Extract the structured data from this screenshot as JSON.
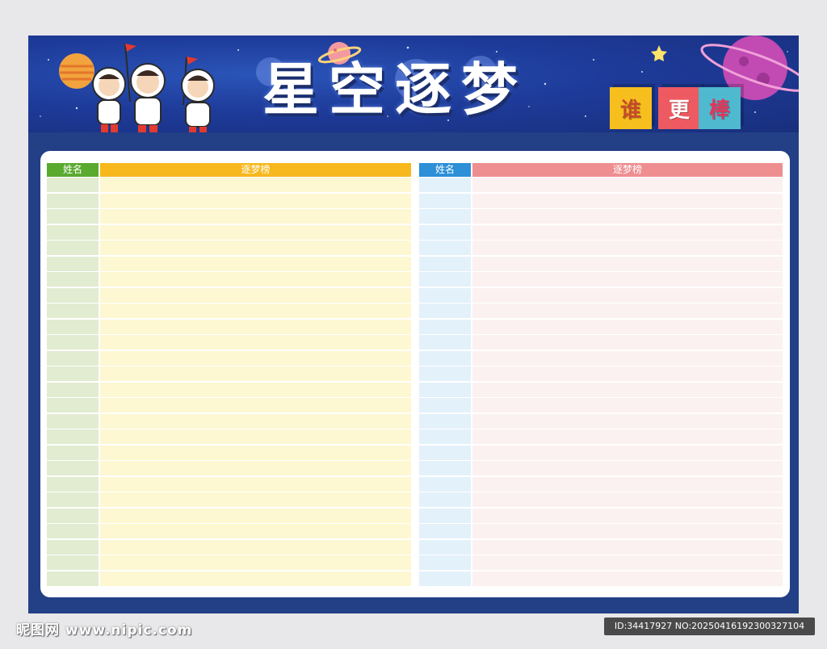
{
  "poster": {
    "title": "星空逐梦",
    "badges": [
      "谁",
      "更",
      "棒"
    ]
  },
  "tables": [
    {
      "name_header": "姓名",
      "rank_header": "逐梦榜",
      "name_header_color": "#5aaa30",
      "rank_header_color": "#f7b81d",
      "name_col_color": "#e2ecd1",
      "rank_col_color": "#fdf7d2",
      "row_count": 26
    },
    {
      "name_header": "姓名",
      "rank_header": "逐梦榜",
      "name_header_color": "#2c8fd7",
      "rank_header_color": "#ee8e91",
      "name_col_color": "#e3f1fb",
      "rank_col_color": "#fcf1f1",
      "row_count": 26
    }
  ],
  "watermark": {
    "site": "昵图网 www.nipic.com",
    "id_text": "ID:34417927 NO:20250416192300327104"
  }
}
